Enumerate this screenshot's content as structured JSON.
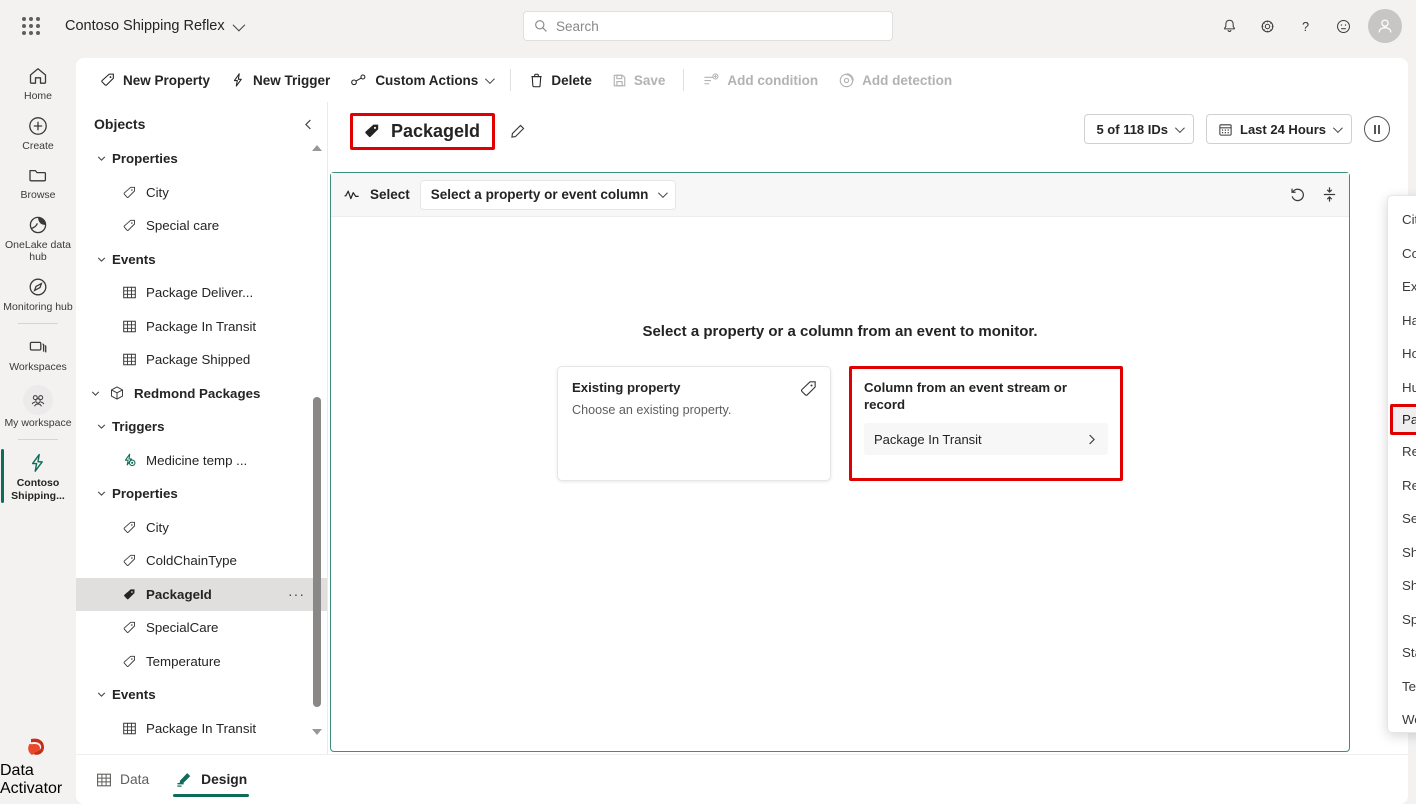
{
  "header": {
    "waffle_icon": "waffle-grid-icon",
    "workspace_title": "Contoso Shipping Reflex",
    "search": {
      "placeholder": "Search",
      "icon": "search-icon"
    },
    "icons": {
      "notifications": "bell-icon",
      "settings": "gear-icon",
      "help": "question-mark-icon",
      "feedback": "smiley-icon",
      "account": "avatar-person-icon"
    }
  },
  "rail": {
    "items": [
      {
        "label": "Home",
        "icon": "home-icon",
        "active": false
      },
      {
        "label": "Create",
        "icon": "plus-circle-icon",
        "active": false
      },
      {
        "label": "Browse",
        "icon": "folder-icon",
        "active": false
      },
      {
        "label": "OneLake data hub",
        "icon": "onelake-icon",
        "active": false
      },
      {
        "label": "Monitoring hub",
        "icon": "monitoring-icon",
        "active": false
      },
      {
        "label": "Workspaces",
        "icon": "workspaces-icon",
        "active": false
      },
      {
        "label": "My workspace",
        "icon": "my-workspace-icon",
        "active": false
      },
      {
        "label": "Contoso Shipping...",
        "icon": "reflex-bolt-icon",
        "active": true
      }
    ],
    "bottom": {
      "label": "Data Activator",
      "icon": "data-activator-logo"
    }
  },
  "toolbar": {
    "new_property": "New Property",
    "new_trigger": "New Trigger",
    "custom_actions": "Custom Actions",
    "delete": "Delete",
    "save": "Save",
    "add_condition": "Add condition",
    "add_detection": "Add detection"
  },
  "objects_panel": {
    "title": "Objects",
    "collapse_icon": "chevron-left-icon",
    "tree": [
      {
        "label": "Properties",
        "kind": "group",
        "indent": 1,
        "expanded": true
      },
      {
        "label": "City",
        "kind": "property",
        "indent": 2
      },
      {
        "label": "Special care",
        "kind": "property",
        "indent": 2
      },
      {
        "label": "Events",
        "kind": "group",
        "indent": 1,
        "expanded": true
      },
      {
        "label": "Package Deliver...",
        "kind": "event",
        "indent": 2
      },
      {
        "label": "Package In Transit",
        "kind": "event",
        "indent": 2
      },
      {
        "label": "Package Shipped",
        "kind": "event",
        "indent": 2
      },
      {
        "label": "Redmond Packages",
        "kind": "object",
        "indent": 0,
        "expanded": true
      },
      {
        "label": "Triggers",
        "kind": "group",
        "indent": 1,
        "expanded": true
      },
      {
        "label": "Medicine temp ...",
        "kind": "trigger",
        "indent": 2
      },
      {
        "label": "Properties",
        "kind": "group",
        "indent": 1,
        "expanded": true
      },
      {
        "label": "City",
        "kind": "property",
        "indent": 2
      },
      {
        "label": "ColdChainType",
        "kind": "property",
        "indent": 2
      },
      {
        "label": "PackageId",
        "kind": "property",
        "indent": 2,
        "selected": true,
        "overflow": "···"
      },
      {
        "label": "SpecialCare",
        "kind": "property",
        "indent": 2
      },
      {
        "label": "Temperature",
        "kind": "property",
        "indent": 2
      },
      {
        "label": "Events",
        "kind": "group",
        "indent": 1,
        "expanded": true
      },
      {
        "label": "Package In Transit",
        "kind": "event",
        "indent": 2
      }
    ]
  },
  "property_header": {
    "title": "PackageId",
    "icon": "tag-filled-icon",
    "edit_icon": "pencil-icon",
    "annotated": true,
    "id_filter": "5 of 118 IDs",
    "time_range": "Last 24 Hours",
    "time_range_icon": "calendar-icon",
    "pause_icon": "pause-circle-icon"
  },
  "canvas": {
    "select_label": "Select",
    "select_label_icon": "sparkline-icon",
    "combo_value": "Select a property or event column",
    "reset_icon": "undo-arrow-icon",
    "fit_icon": "fit-vertical-icon",
    "empty_heading": "Select a property or a column from an event to monitor.",
    "cards": [
      {
        "title": "Existing property",
        "subtitle": "Choose an existing property.",
        "icon": "tag-outline-icon",
        "annotated": false
      },
      {
        "title": "Column from an event stream or record",
        "option": "Package In Transit",
        "option_icon": "chevron-right-icon",
        "annotated": true
      }
    ]
  },
  "dropdown": {
    "items": [
      {
        "label": "City"
      },
      {
        "label": "ColdChainType"
      },
      {
        "label": "Exception"
      },
      {
        "label": "HasException"
      },
      {
        "label": "HoursInTransit"
      },
      {
        "label": "Humidity"
      },
      {
        "label": "PackageId",
        "highlighted": true,
        "annotated": true
      },
      {
        "label": "Recipient"
      },
      {
        "label": "RecipientEmail"
      },
      {
        "label": "ServiceType"
      },
      {
        "label": "Shipper"
      },
      {
        "label": "ShipperEmail"
      },
      {
        "label": "SpecialCare"
      },
      {
        "label": "State"
      },
      {
        "label": "Temperature"
      },
      {
        "label": "Weight"
      }
    ]
  },
  "bottom_tabs": [
    {
      "label": "Data",
      "icon": "table-grid-icon",
      "active": false
    },
    {
      "label": "Design",
      "icon": "design-pen-icon",
      "active": true
    }
  ],
  "colors": {
    "accent_green": "#0f6c5a",
    "canvas_border": "#3d8f7d",
    "annotation_red": "#e00000",
    "chrome_gray": "#f3f2f1"
  }
}
